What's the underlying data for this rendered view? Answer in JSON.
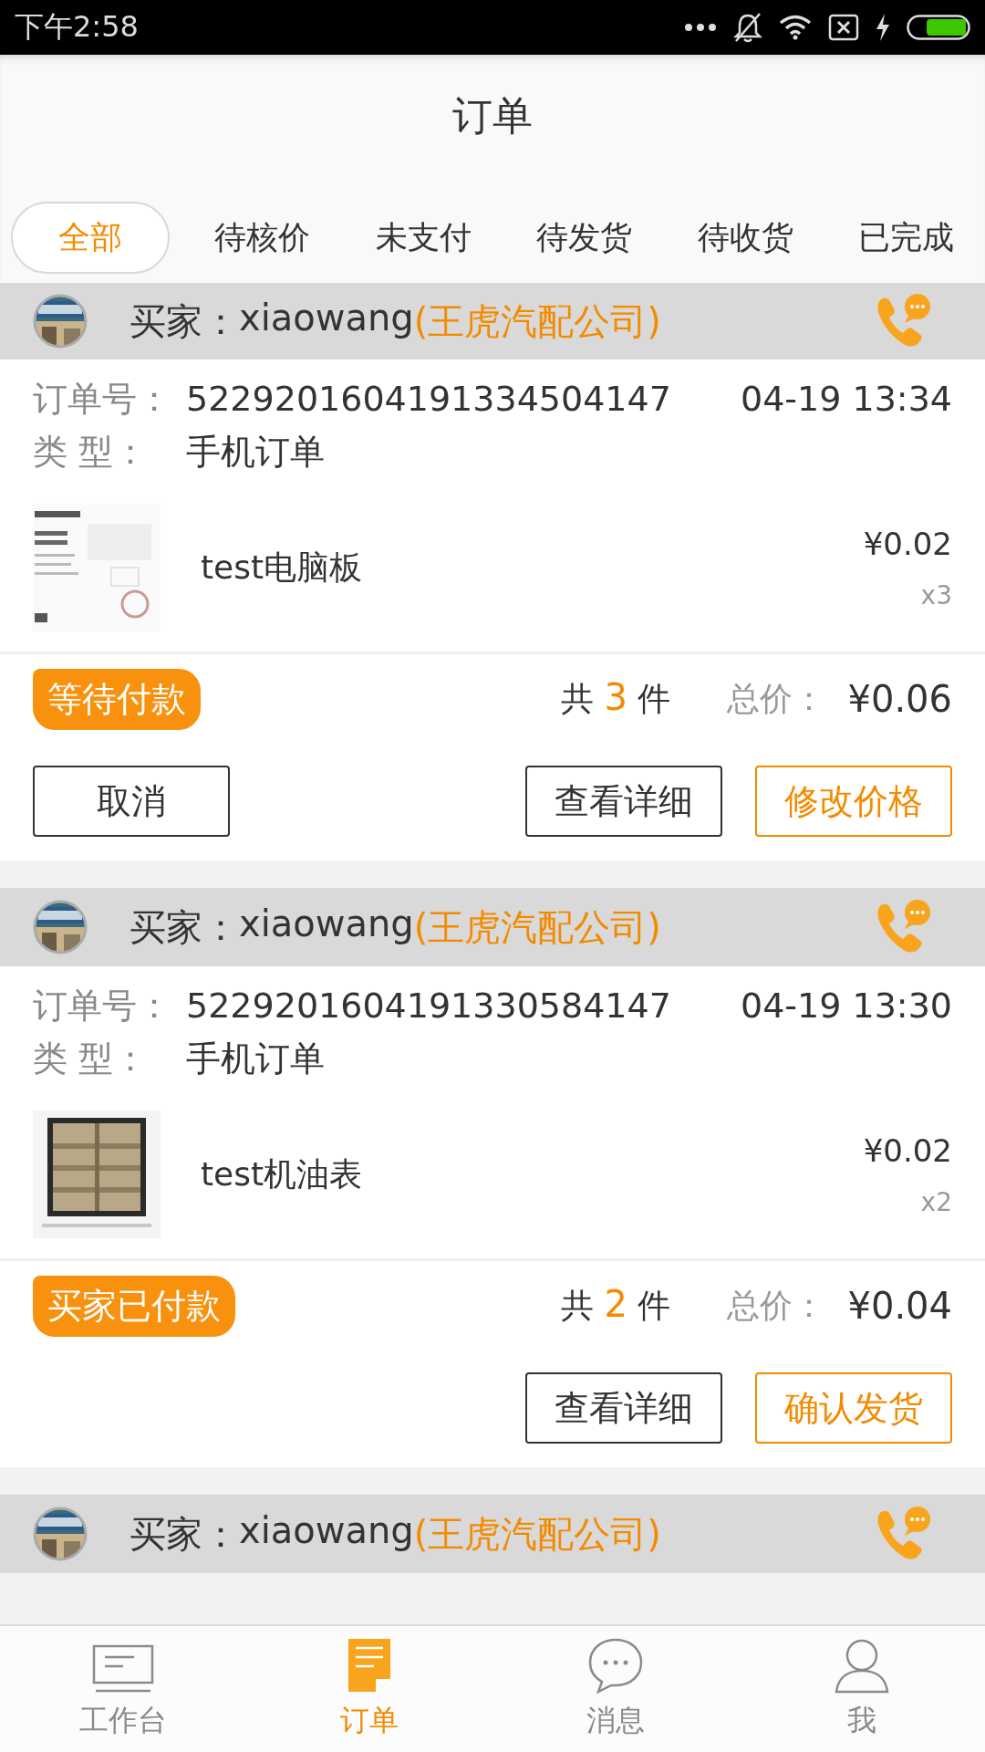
{
  "status_bar": {
    "time": "下午2:58"
  },
  "header": {
    "title": "订单"
  },
  "tabs": [
    {
      "label": "全部",
      "selected": true
    },
    {
      "label": "待核价",
      "selected": false
    },
    {
      "label": "未支付",
      "selected": false
    },
    {
      "label": "待发货",
      "selected": false
    },
    {
      "label": "待收货",
      "selected": false
    },
    {
      "label": "已完成",
      "selected": false
    }
  ],
  "orders": [
    {
      "buyer_label": "买家：",
      "buyer": "xiaowang",
      "company": "(王虎汽配公司)",
      "order_no_label": "订单号：",
      "order_no": "5229201604191334504147",
      "time": "04-19 13:34",
      "type_label": "类 型：",
      "type": "手机订单",
      "items": [
        {
          "name": "test电脑板",
          "price": "¥0.02",
          "qty": "x3"
        }
      ],
      "status": "等待付款",
      "count_prefix": "共",
      "count": "3",
      "count_suffix": "件",
      "total_label": "总价：",
      "total": "¥0.06",
      "buttons": [
        {
          "label": "取消",
          "kind": "cancel"
        },
        {
          "label": "查看详细",
          "kind": "secondary"
        },
        {
          "label": "修改价格",
          "kind": "primary"
        }
      ]
    },
    {
      "buyer_label": "买家：",
      "buyer": "xiaowang",
      "company": "(王虎汽配公司)",
      "order_no_label": "订单号：",
      "order_no": "5229201604191330584147",
      "time": "04-19 13:30",
      "type_label": "类 型：",
      "type": "手机订单",
      "items": [
        {
          "name": "test机油表",
          "price": "¥0.02",
          "qty": "x2"
        }
      ],
      "status": "买家已付款",
      "count_prefix": "共",
      "count": "2",
      "count_suffix": "件",
      "total_label": "总价：",
      "total": "¥0.04",
      "buttons": [
        {
          "label": "查看详细",
          "kind": "secondary"
        },
        {
          "label": "确认发货",
          "kind": "primary"
        }
      ]
    },
    {
      "buyer_label": "买家：",
      "buyer": "xiaowang",
      "company": "(王虎汽配公司)"
    }
  ],
  "bottom_nav": [
    {
      "label": "工作台",
      "selected": false
    },
    {
      "label": "订单",
      "selected": true
    },
    {
      "label": "消息",
      "selected": false
    },
    {
      "label": "我",
      "selected": false
    }
  ]
}
